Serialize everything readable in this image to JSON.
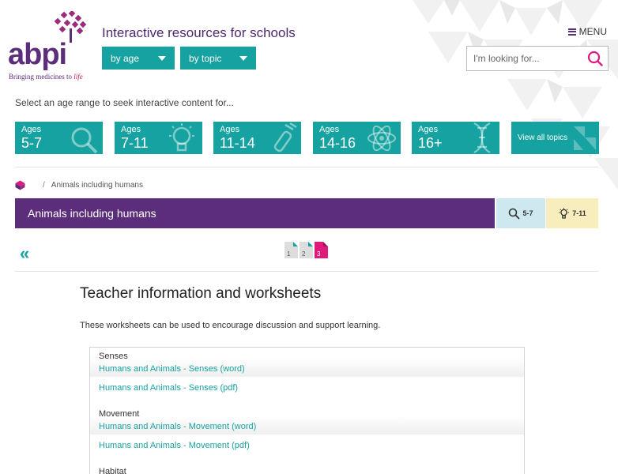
{
  "header": {
    "logo_text": "abpi",
    "logo_tagline_prefix": "Bringing medicines to ",
    "logo_tagline_emphasis": "life",
    "site_title": "Interactive resources for schools",
    "dropdown_age": "by age",
    "dropdown_topic": "by topic",
    "menu_label": "MENU",
    "search_placeholder": "I'm looking for..."
  },
  "intro_text": "Select an age range to seek interactive content for...",
  "age_tiles": [
    {
      "small": "Ages",
      "big": "5-7",
      "icon": "magnifier-icon"
    },
    {
      "small": "Ages",
      "big": "7-11",
      "icon": "lightbulb-icon"
    },
    {
      "small": "Ages",
      "big": "11-14",
      "icon": "test-tube-icon"
    },
    {
      "small": "Ages",
      "big": "14-16",
      "icon": "atom-icon"
    },
    {
      "small": "Ages",
      "big": "16+",
      "icon": "dna-icon"
    }
  ],
  "view_all_label": "View all topics",
  "breadcrumb": {
    "home_icon": "home-icon",
    "separator": "/",
    "current": "Animals including humans"
  },
  "page_title": "Animals including humans",
  "age_badges": [
    {
      "label": "5-7",
      "icon": "magnifier-icon"
    },
    {
      "label": "7-11",
      "icon": "lightbulb-icon"
    }
  ],
  "pagination": {
    "pages": [
      "1",
      "2",
      "3"
    ],
    "active": "3"
  },
  "content": {
    "heading": "Teacher information and worksheets",
    "description": "These worksheets can be used to encourage discussion and support learning.",
    "groups": [
      {
        "title": "Senses",
        "links": [
          "Humans and Animals - Senses (word)",
          "Humans and Animals - Senses (pdf)"
        ]
      },
      {
        "title": "Movement",
        "links": [
          "Humans and Animals - Movement (word)",
          "Humans and Animals - Movement (pdf)"
        ]
      },
      {
        "title": "Habitat",
        "links": []
      }
    ]
  },
  "colors": {
    "teal": "#16a2a0",
    "purple": "#5c2d7a",
    "pink": "#e0197d",
    "badge_blue": "#cde8ef",
    "badge_yellow": "#f7edbd"
  }
}
